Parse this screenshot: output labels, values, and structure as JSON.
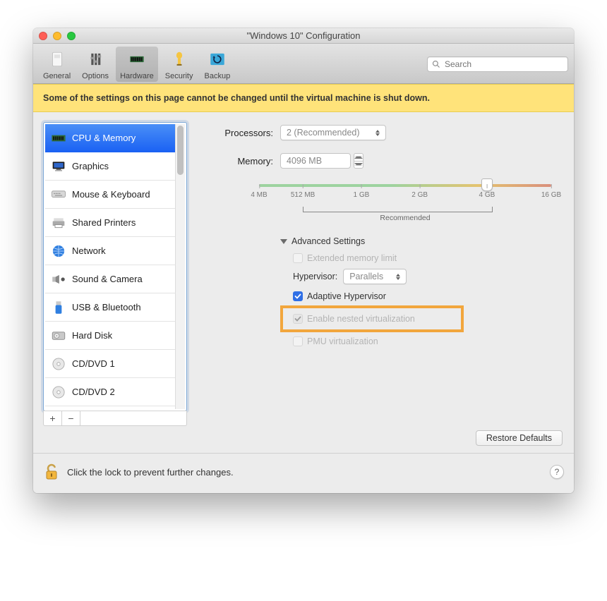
{
  "window": {
    "title": "\"Windows 10\" Configuration"
  },
  "toolbar": {
    "items": [
      {
        "label": "General"
      },
      {
        "label": "Options"
      },
      {
        "label": "Hardware"
      },
      {
        "label": "Security"
      },
      {
        "label": "Backup"
      }
    ],
    "search_placeholder": "Search"
  },
  "banner": {
    "text": "Some of the settings on this page cannot be changed until the virtual machine is shut down."
  },
  "sidebar": {
    "items": [
      {
        "label": "CPU & Memory"
      },
      {
        "label": "Graphics"
      },
      {
        "label": "Mouse & Keyboard"
      },
      {
        "label": "Shared Printers"
      },
      {
        "label": "Network"
      },
      {
        "label": "Sound & Camera"
      },
      {
        "label": "USB & Bluetooth"
      },
      {
        "label": "Hard Disk"
      },
      {
        "label": "CD/DVD 1"
      },
      {
        "label": "CD/DVD 2"
      }
    ],
    "add": "+",
    "remove": "−"
  },
  "cpu": {
    "processors_label": "Processors:",
    "processors_value": "2 (Recommended)",
    "memory_label": "Memory:",
    "memory_value": "4096 MB",
    "slider_ticks": [
      "4 MB",
      "512 MB",
      "1 GB",
      "2 GB",
      "4 GB",
      "16 GB"
    ],
    "recommended_label": "Recommended",
    "advanced_title": "Advanced Settings",
    "ext_mem_label": "Extended memory limit",
    "hypervisor_label": "Hypervisor:",
    "hypervisor_value": "Parallels",
    "adaptive_label": "Adaptive Hypervisor",
    "nested_label": "Enable nested virtualization",
    "pmu_label": "PMU virtualization",
    "restore_label": "Restore Defaults"
  },
  "footer": {
    "text": "Click the lock to prevent further changes.",
    "help": "?"
  }
}
